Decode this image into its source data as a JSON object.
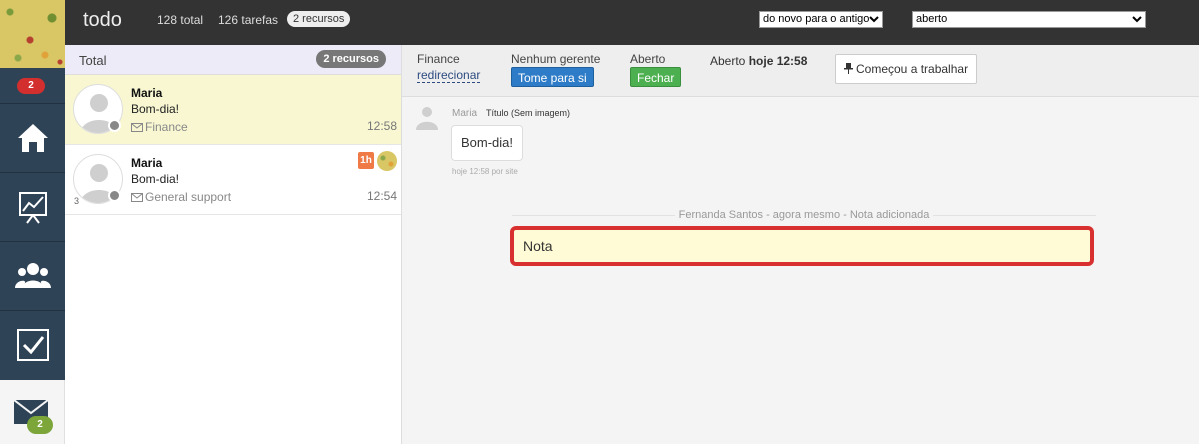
{
  "topbar": {
    "title": "todo",
    "stat_total": "128 total",
    "stat_tasks": "126 tarefas",
    "resources_pill": "2 recursos",
    "sort_select": "do novo para o antigo",
    "status_select": "aberto"
  },
  "rail": {
    "alert_badge": "2",
    "items": [
      "home-icon",
      "chart-icon",
      "team-icon",
      "checkbox-icon"
    ],
    "mail_badge": "2"
  },
  "list": {
    "header_label": "Total",
    "header_count": "2 recursos",
    "tickets": [
      {
        "name": "Maria",
        "message": "Bom-dia!",
        "queue": "Finance",
        "time": "12:58",
        "active": true
      },
      {
        "name": "Maria",
        "message": "Bom-dia!",
        "queue": "General support",
        "time": "12:54",
        "number": "3",
        "sla": "1h"
      }
    ]
  },
  "detail": {
    "queue_label": "Finance",
    "redirect_link": "redirecionar",
    "manager_label": "Nenhum gerente",
    "take_button": "Tome para si",
    "status_label": "Aberto",
    "close_button": "Fechar",
    "opened_label": "Aberto",
    "opened_time": "hoje 12:58",
    "start_work_button": "Começou a trabalhar",
    "message": {
      "author": "Maria",
      "subject": "Título (Sem imagem)",
      "text": "Bom-dia!",
      "meta": "hoje 12:58 por site"
    },
    "note": {
      "meta": "Fernanda Santos - agora mesmo - Nota adicionada",
      "text": "Nota"
    }
  },
  "colors": {
    "rail": "#2f4357",
    "topbar": "#333333",
    "highlight": "#d8302e",
    "active_row": "#f8f7d2"
  }
}
